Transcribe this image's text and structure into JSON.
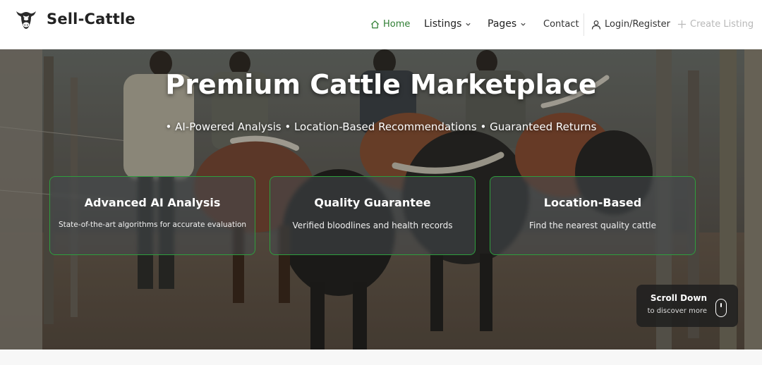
{
  "brand": {
    "name": "Sell-Cattle",
    "logo_icon": "cow-head-icon"
  },
  "nav": {
    "home": "Home",
    "listings": "Listings",
    "pages": "Pages",
    "contact": "Contact",
    "login": "Login/Register",
    "create": "Create Listing"
  },
  "hero": {
    "title": "Premium Cattle Marketplace",
    "subtitle": "• AI-Powered Analysis • Location-Based Recommendations • Guaranteed Returns"
  },
  "cards": [
    {
      "title": "Advanced AI Analysis",
      "desc": "State-of-the-art algorithms for accurate evaluation"
    },
    {
      "title": "Quality Guarantee",
      "desc": "Verified bloodlines and health records"
    },
    {
      "title": "Location-Based",
      "desc": "Find the nearest quality cattle"
    }
  ],
  "scroll": {
    "title": "Scroll Down",
    "subtitle": "to discover more"
  },
  "colors": {
    "accent": "#2e7d32",
    "card_border": "#2e9e3e",
    "disabled": "#b8b8b8"
  }
}
